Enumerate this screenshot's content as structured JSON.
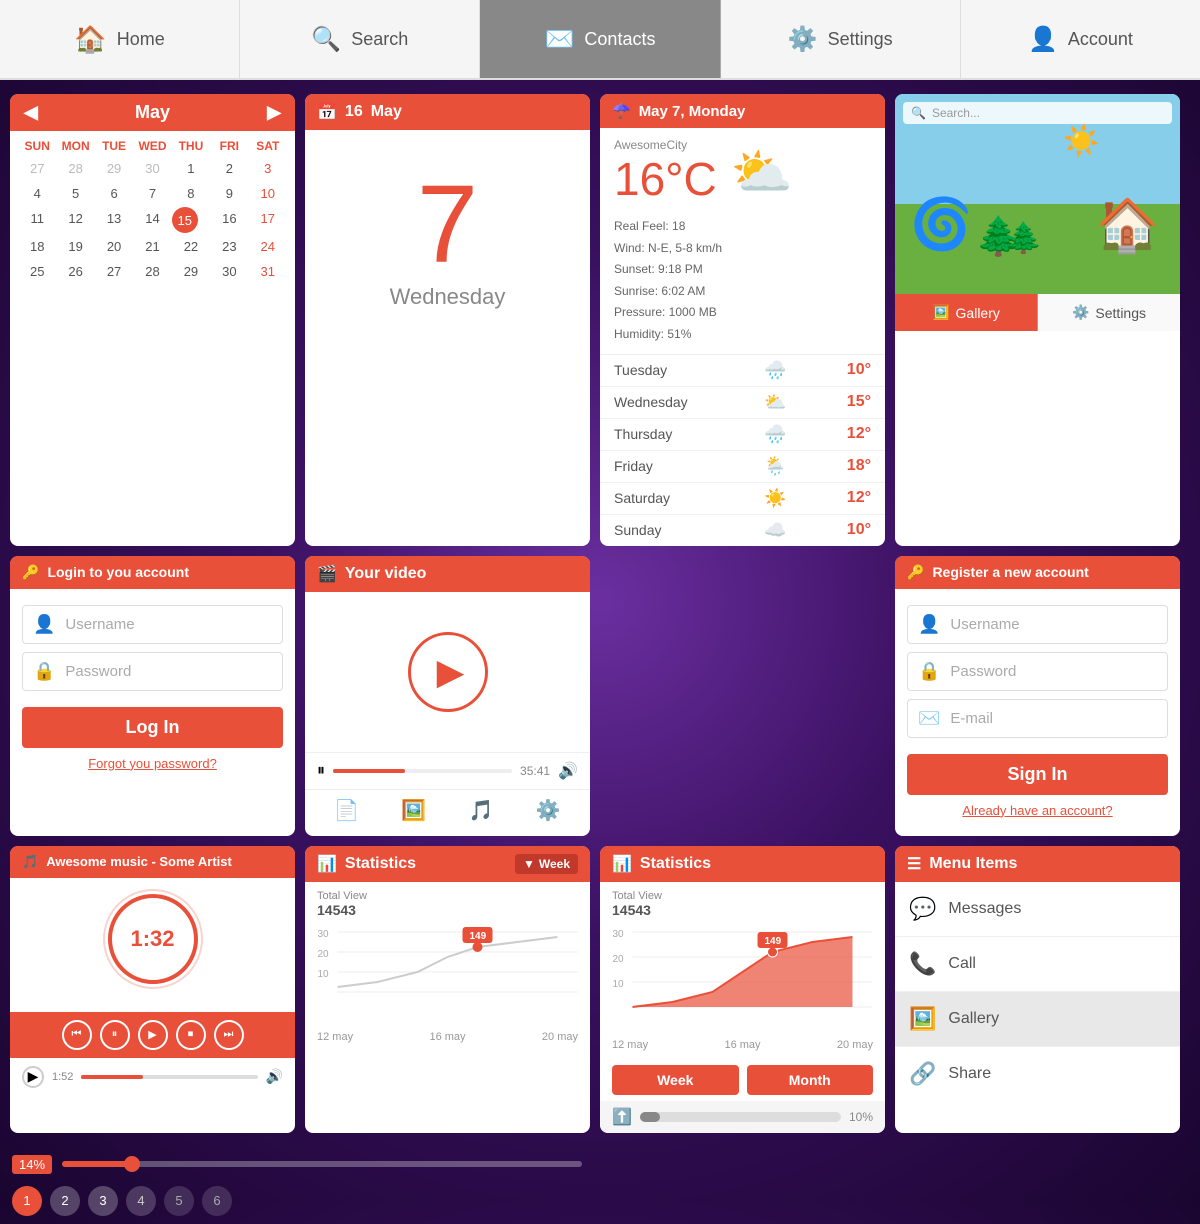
{
  "nav": {
    "items": [
      {
        "label": "Home",
        "icon": "🏠",
        "id": "home",
        "active": false
      },
      {
        "label": "Search",
        "icon": "🔍",
        "id": "search",
        "active": false
      },
      {
        "label": "Contacts",
        "icon": "✉️",
        "id": "contacts",
        "active": true
      },
      {
        "label": "Settings",
        "icon": "⚙️",
        "id": "settings",
        "active": false
      },
      {
        "label": "Account",
        "icon": "👤",
        "id": "account",
        "active": false
      }
    ]
  },
  "calendar": {
    "month": "May",
    "days_headers": [
      "SUN",
      "MON",
      "TUE",
      "WED",
      "THU",
      "FRI",
      "SAT"
    ],
    "weeks": [
      [
        "27",
        "28",
        "29",
        "30",
        "1",
        "2",
        "3"
      ],
      [
        "4",
        "5",
        "6",
        "7",
        "8",
        "9",
        "10"
      ],
      [
        "11",
        "12",
        "13",
        "14",
        "15",
        "16",
        "17"
      ],
      [
        "18",
        "19",
        "20",
        "21",
        "22",
        "23",
        "24"
      ],
      [
        "25",
        "26",
        "27",
        "28",
        "29",
        "30",
        "31"
      ]
    ],
    "today": "15"
  },
  "date_widget": {
    "header": "May",
    "calendar_icon": "📅",
    "date_number": "7",
    "day_name": "Wednesday"
  },
  "weather": {
    "header": "May 7, Monday",
    "umbrella_icon": "☂️",
    "city": "AwesomeCity",
    "temp": "16°C",
    "real_feel": "Real Feel: 18",
    "wind": "Wind: N-E, 5-8 km/h",
    "sunrise": "Sunrise: 6:02 AM",
    "sunset": "Sunset: 9:18 PM",
    "pressure": "Pressure: 1000 MB",
    "humidity": "Humidity: 51%",
    "forecast": [
      {
        "day": "Tuesday",
        "icon": "🌧️",
        "temp": "10°"
      },
      {
        "day": "Wednesday",
        "icon": "⛅",
        "temp": "15°"
      },
      {
        "day": "Thursday",
        "icon": "🌧️",
        "temp": "12°"
      },
      {
        "day": "Friday",
        "icon": "🌦️",
        "temp": "18°"
      },
      {
        "day": "Saturday",
        "icon": "☀️",
        "temp": "12°"
      },
      {
        "day": "Sunday",
        "icon": "☁️",
        "temp": "10°"
      }
    ]
  },
  "scene": {
    "gallery_label": "Gallery",
    "settings_label": "Settings"
  },
  "login": {
    "header": "Login to you account",
    "key_icon": "🔑",
    "username_placeholder": "Username",
    "password_placeholder": "Password",
    "user_icon": "👤",
    "lock_icon": "🔒",
    "login_btn": "Log In",
    "forgot_link": "Forgot you password?"
  },
  "video": {
    "header": "Your video",
    "video_icon": "🎬",
    "time": "35:41",
    "tabs": [
      "📄",
      "🖼️",
      "🎵",
      "⚙️"
    ]
  },
  "music": {
    "header": "Awesome music - Some Artist",
    "note_icon": "🎵",
    "time": "1:32",
    "controls": [
      "⏮",
      "⏸",
      "▶",
      "⏹",
      "⏭"
    ]
  },
  "stats_week": {
    "header": "Statistics",
    "week_label": "Week",
    "total_label": "Total View",
    "total_num": "14543",
    "peak": "149",
    "dates": [
      "12 may",
      "16 may",
      "20 may"
    ]
  },
  "stats_main": {
    "header": "Statistics",
    "total_label": "Total View",
    "total_num": "14543",
    "peak": "149",
    "dates": [
      "12 may",
      "16 may",
      "20 may"
    ],
    "week_btn": "Week",
    "month_btn": "Month",
    "upload_pct": "10%"
  },
  "register": {
    "header": "Register a new account",
    "key_icon": "🔑",
    "username_placeholder": "Username",
    "password_placeholder": "Password",
    "email_placeholder": "E-mail",
    "user_icon": "👤",
    "lock_icon": "🔒",
    "mail_icon": "✉️",
    "signin_btn": "Sign In",
    "account_link": "Already have an account?"
  },
  "menu": {
    "header": "Menu Items",
    "items": [
      {
        "label": "Messages",
        "icon": "💬"
      },
      {
        "label": "Call",
        "icon": "📞"
      },
      {
        "label": "Gallery",
        "icon": "🖼️",
        "highlighted": true
      },
      {
        "label": "Share",
        "icon": "🔗"
      }
    ]
  },
  "slider": {
    "pct": "14%",
    "fill_pct": 14
  },
  "pagination": {
    "pages": [
      "1",
      "2",
      "3",
      "4",
      "5",
      "6"
    ],
    "active": "1"
  }
}
